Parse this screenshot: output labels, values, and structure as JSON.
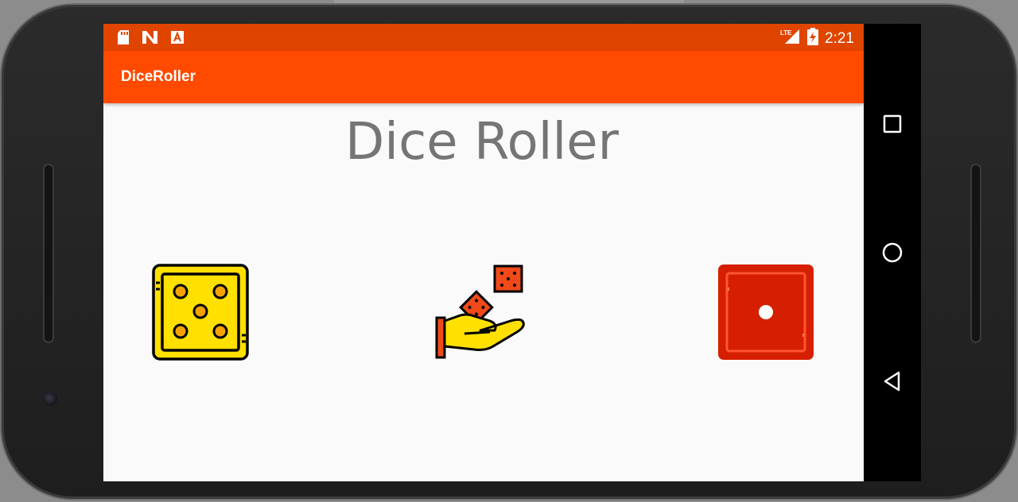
{
  "status_bar": {
    "icons": [
      "sd-card-icon",
      "n-notification-icon",
      "a-notification-icon",
      "lte-signal-icon",
      "battery-charging-icon"
    ],
    "network_label": "LTE",
    "time": "2:21"
  },
  "app_bar": {
    "title": "DiceRoller"
  },
  "main": {
    "heading": "Dice Roller",
    "left_die": {
      "icon": "dice-five-icon",
      "color": "#ffe000",
      "pips": 5
    },
    "center_image": {
      "icon": "hand-throwing-dice-icon"
    },
    "right_die": {
      "icon": "dice-one-icon",
      "color": "#d61f00",
      "pips": 1
    }
  },
  "nav_bar": {
    "buttons": [
      "recents-icon",
      "home-icon",
      "back-icon"
    ]
  },
  "colors": {
    "status_bar": "#e04500",
    "app_bar": "#ff4a00",
    "background": "#fafafa",
    "heading_text": "#757575"
  }
}
